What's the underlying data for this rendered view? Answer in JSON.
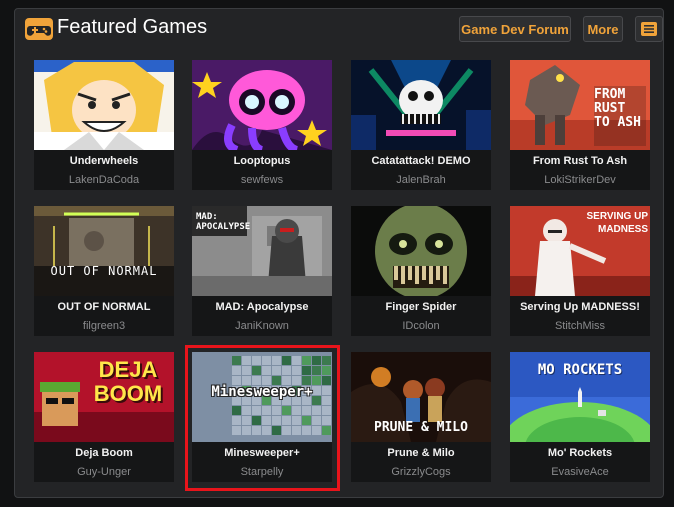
{
  "header": {
    "title": "Featured Games",
    "forum_button": "Game Dev Forum",
    "more_button": "More",
    "accent": "#f0a33a",
    "icons": {
      "logo": "gamepad-icon",
      "menu": "menu-icon"
    }
  },
  "games": [
    {
      "name": "Underwheels",
      "author": "LakenDaCoda"
    },
    {
      "name": "Looptopus",
      "author": "sewfews"
    },
    {
      "name": "Catatattack! DEMO",
      "author": "JalenBrah"
    },
    {
      "name": "From Rust To Ash",
      "author": "LokiStrikerDev"
    },
    {
      "name": "OUT OF NORMAL",
      "author": "filgreen3"
    },
    {
      "name": "MAD: Apocalypse",
      "author": "JaniKnown"
    },
    {
      "name": "Finger Spider",
      "author": "IDcolon"
    },
    {
      "name": "Serving Up MADNESS!",
      "author": "StitchMiss"
    },
    {
      "name": "Deja Boom",
      "author": "Guy-Unger"
    },
    {
      "name": "Minesweeper+",
      "author": "Starpelly"
    },
    {
      "name": "Prune & Milo",
      "author": "GrizzlyCogs"
    },
    {
      "name": "Mo' Rockets",
      "author": "EvasiveAce"
    }
  ],
  "thumb_text": {
    "rust": "FROM RUST TO ASH",
    "out_normal": "OUT OF NORMAL",
    "mad": "MAD: APOCALYPSE",
    "serving": "SERVING UP MADNESS",
    "deja": "DEJA BOOM",
    "mines": "Minesweeper+",
    "prune": "PRUNE & MILO",
    "rockets": "MO ROCKETS"
  },
  "selected_game": "Minesweeper+",
  "highlight_color": "#e8141b"
}
